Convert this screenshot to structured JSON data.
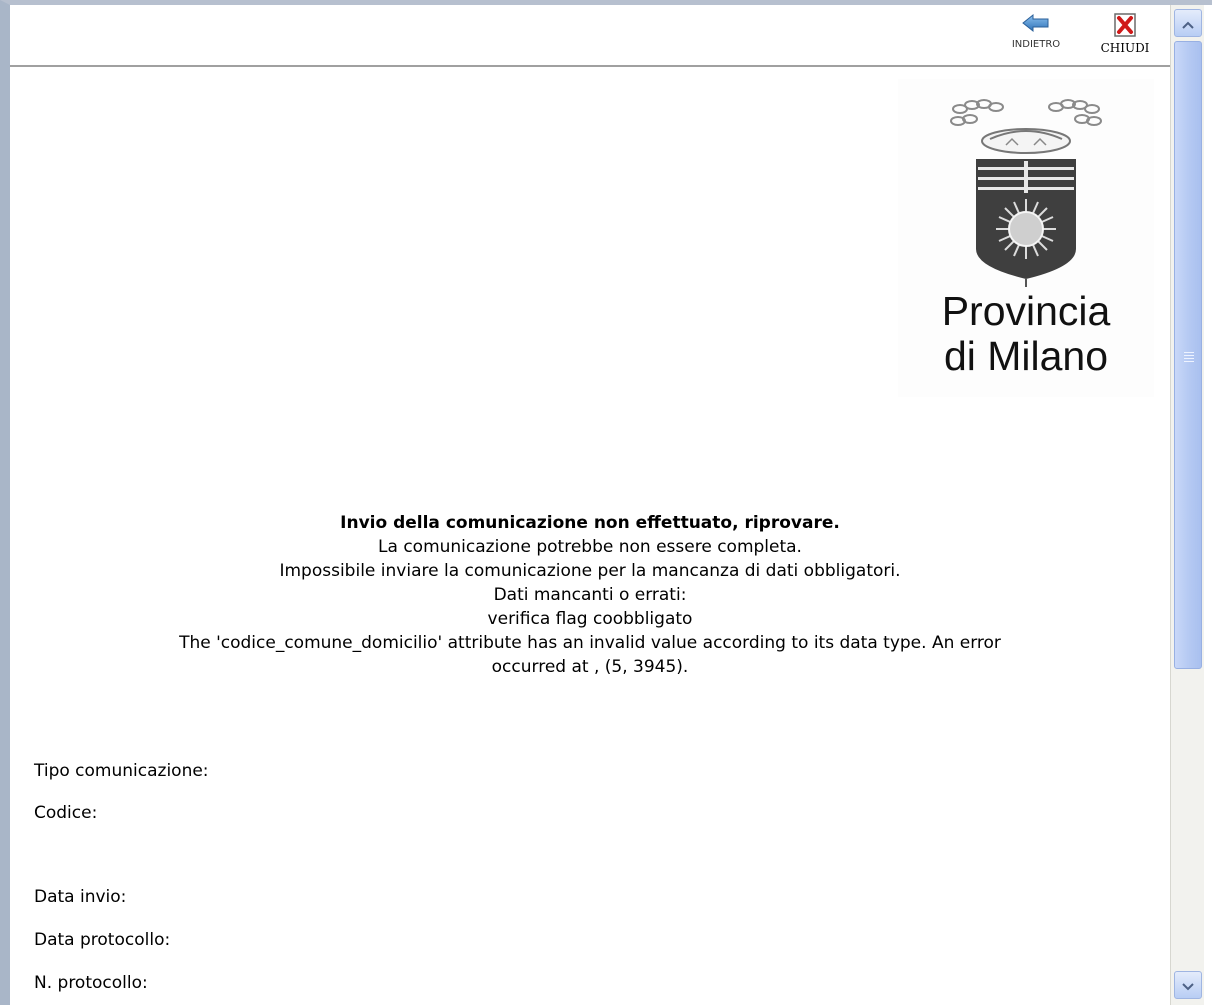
{
  "toolbar": {
    "back_label": "INDIETRO",
    "close_label": "CHIUDI"
  },
  "logo": {
    "line1": "Provincia",
    "line2": "di Milano"
  },
  "message": {
    "title": "Invio della comunicazione non effettuato, riprovare.",
    "line1": "La comunicazione potrebbe non essere completa.",
    "line2": "Impossibile inviare la comunicazione per la mancanza di dati obbligatori.",
    "line3": "Dati mancanti o errati:",
    "line4": "verifica flag coobbligato",
    "line5": "The 'codice_comune_domicilio' attribute has an invalid value according to its data type. An error",
    "line6": "occurred at , (5, 3945)."
  },
  "fields": {
    "tipo": "Tipo comunicazione:",
    "codice": "Codice:",
    "data_invio": "Data invio:",
    "data_protocollo": "Data protocollo:",
    "n_protocollo": "N. protocollo:"
  },
  "colors": {
    "back_arrow": "#4a8fd0",
    "close_red": "#d01818",
    "scroll_accent": "#b6caf3"
  },
  "icons": {
    "back": "arrow-left-icon",
    "close": "close-x-icon",
    "scroll_up": "chevron-up-icon",
    "scroll_down": "chevron-down-icon"
  }
}
